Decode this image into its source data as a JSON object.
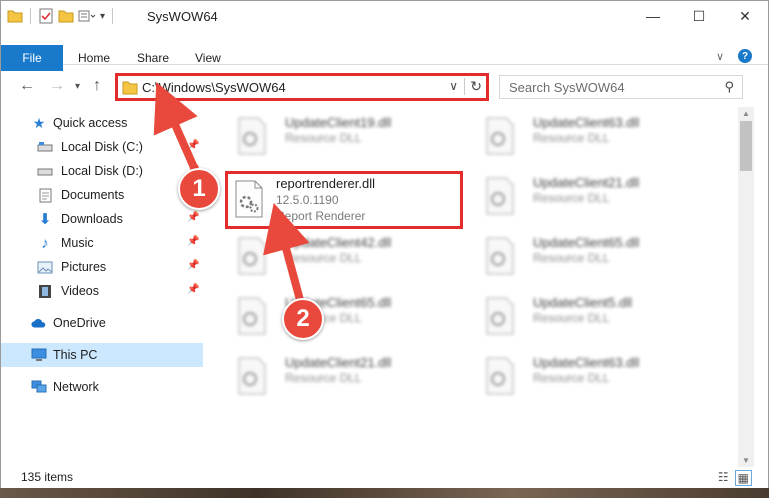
{
  "window": {
    "title": "SysWOW64"
  },
  "ribbon": {
    "tabs": [
      "File",
      "Home",
      "Share",
      "View"
    ],
    "help_label": "?"
  },
  "address": {
    "path": "C:\\Windows\\SysWOW64"
  },
  "search": {
    "placeholder": "Search SysWOW64"
  },
  "sidebar": {
    "items": [
      {
        "label": "Quick access"
      },
      {
        "label": "Local Disk (C:)"
      },
      {
        "label": "Local Disk (D:)"
      },
      {
        "label": "Documents"
      },
      {
        "label": "Downloads"
      },
      {
        "label": "Music"
      },
      {
        "label": "Pictures"
      },
      {
        "label": "Videos"
      },
      {
        "label": "OneDrive"
      },
      {
        "label": "This PC"
      },
      {
        "label": "Network"
      }
    ]
  },
  "files": [
    {
      "name": "UpdateClient19.dll",
      "line2": "Resource DLL",
      "line3": ""
    },
    {
      "name": "UpdateClient63.dll",
      "line2": "Resource DLL",
      "line3": ""
    },
    {
      "name": "reportrenderer.dll",
      "line2": "12.5.0.1190",
      "line3": "Report Renderer"
    },
    {
      "name": "UpdateClient21.dll",
      "line2": "Resource DLL",
      "line3": ""
    },
    {
      "name": "UpdateClient42.dll",
      "line2": "Resource DLL",
      "line3": ""
    },
    {
      "name": "UpdateClient65.dll",
      "line2": "Resource DLL",
      "line3": ""
    },
    {
      "name": "UpdateClient65.dll",
      "line2": "Resource DLL",
      "line3": ""
    },
    {
      "name": "UpdateClient5.dll",
      "line2": "Resource DLL",
      "line3": ""
    },
    {
      "name": "UpdateClient21.dll",
      "line2": "Resource DLL",
      "line3": ""
    },
    {
      "name": "UpdateClient63.dll",
      "line2": "Resource DLL",
      "line3": ""
    }
  ],
  "status": {
    "item_count": "135 items"
  },
  "annotations": {
    "step1": "1",
    "step2": "2"
  },
  "colors": {
    "accent": "#1979ca",
    "highlight": "#e32b2b",
    "selection": "#cce8ff"
  }
}
